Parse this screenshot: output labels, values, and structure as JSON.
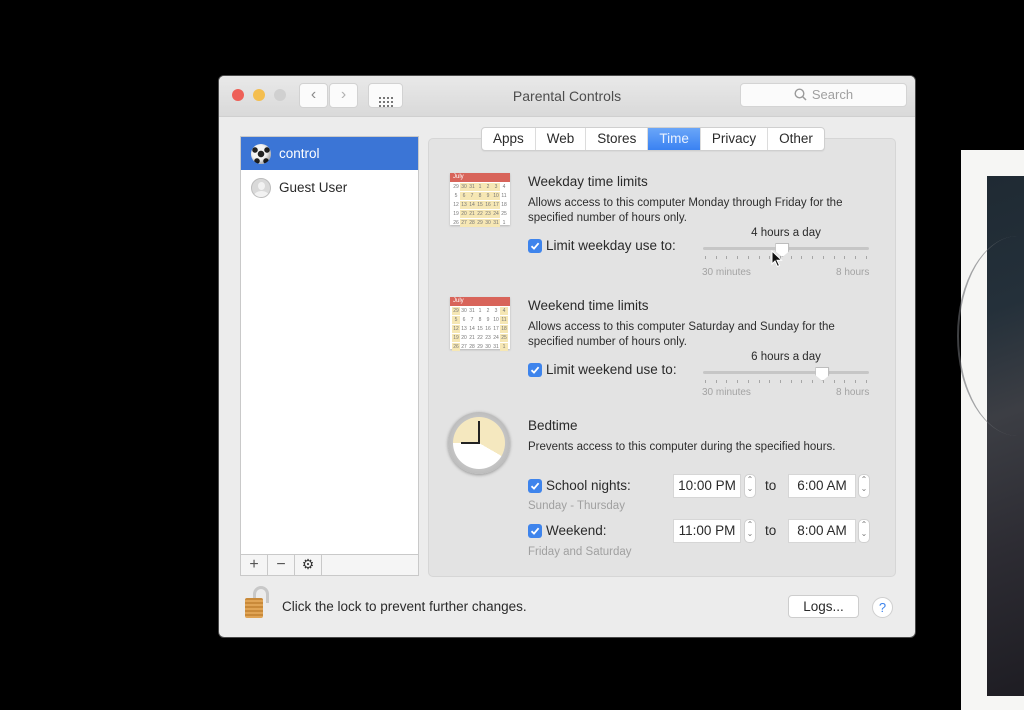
{
  "window": {
    "title": "Parental Controls",
    "search_placeholder": "Search",
    "nav": {
      "back": "‹",
      "forward": "›"
    }
  },
  "users": [
    {
      "name": "control",
      "avatar": "soccer-ball",
      "selected": true
    },
    {
      "name": "Guest User",
      "avatar": "generic-user",
      "selected": false
    }
  ],
  "list_controls": {
    "add": "+",
    "remove": "−",
    "action": "⚙"
  },
  "tabs": [
    {
      "label": "Apps",
      "active": false
    },
    {
      "label": "Web",
      "active": false
    },
    {
      "label": "Stores",
      "active": false
    },
    {
      "label": "Time",
      "active": true
    },
    {
      "label": "Privacy",
      "active": false
    },
    {
      "label": "Other",
      "active": false
    }
  ],
  "weekday": {
    "title": "Weekday time limits",
    "description": "Allows access to this computer Monday through Friday for the specified number of hours only.",
    "checkbox_label": "Limit weekday use to:",
    "checked": true,
    "value_label": "4 hours a day",
    "slider_fraction": 0.47,
    "min_label": "30 minutes",
    "max_label": "8 hours"
  },
  "weekend": {
    "title": "Weekend time limits",
    "description": "Allows access to this computer Saturday and Sunday for the specified number of hours only.",
    "checkbox_label": "Limit weekend use to:",
    "checked": true,
    "value_label": "6 hours a day",
    "slider_fraction": 0.73,
    "min_label": "30 minutes",
    "max_label": "8 hours"
  },
  "calendar": {
    "month": "July",
    "days": [
      "29",
      "30",
      "31",
      "1",
      "2",
      "3",
      "4",
      "5",
      "6",
      "7",
      "8",
      "9",
      "10",
      "11",
      "12",
      "13",
      "14",
      "15",
      "16",
      "17",
      "18",
      "19",
      "20",
      "21",
      "22",
      "23",
      "24",
      "25",
      "26",
      "27",
      "28",
      "29",
      "30",
      "31",
      "1"
    ]
  },
  "bedtime": {
    "title": "Bedtime",
    "description": "Prevents access to this computer during the specified hours.",
    "rows": [
      {
        "label": "School nights:",
        "sublabel": "Sunday - Thursday",
        "checked": true,
        "from": "10:00 PM",
        "to": "6:00 AM"
      },
      {
        "label": "Weekend:",
        "sublabel": "Friday and Saturday",
        "checked": true,
        "from": "11:00 PM",
        "to": "8:00 AM"
      }
    ],
    "to_label": "to"
  },
  "footer": {
    "lock_text": "Click the lock to prevent further changes.",
    "logs_button": "Logs...",
    "help": "?"
  },
  "stepper": {
    "up": "⌃",
    "down": "⌄"
  }
}
